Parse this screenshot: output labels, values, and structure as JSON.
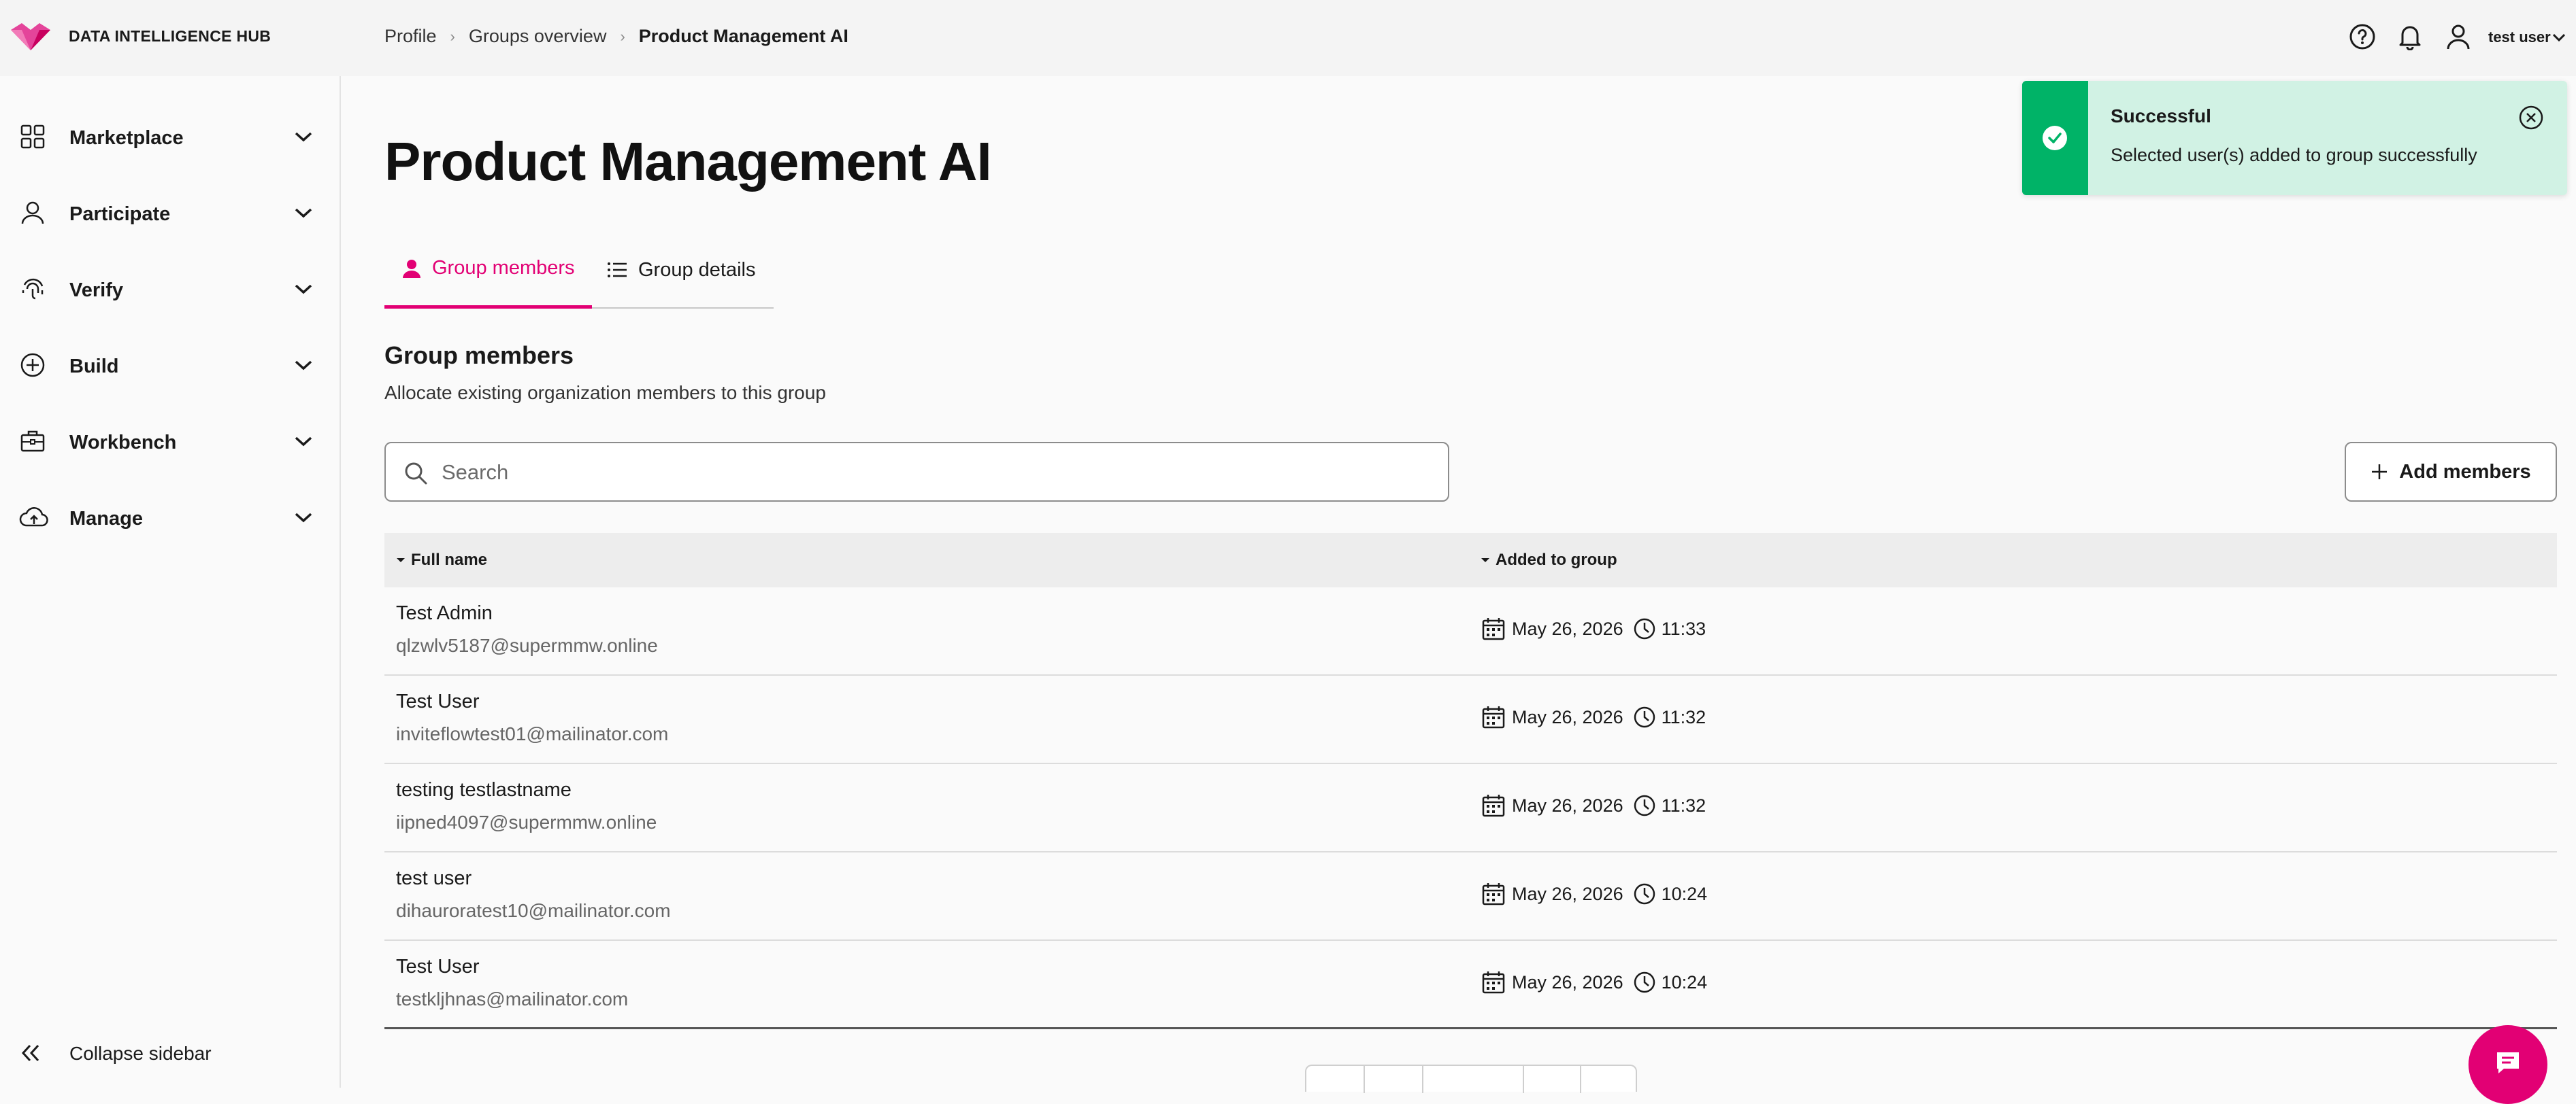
{
  "header": {
    "brand": "DATA INTELLIGENCE HUB",
    "breadcrumb": [
      "Profile",
      "Groups overview",
      "Product Management AI"
    ],
    "user_name": "test user",
    "icons": [
      "help-icon",
      "bell-icon",
      "user-icon",
      "chevron-down-icon"
    ]
  },
  "sidebar": {
    "items": [
      {
        "label": "Marketplace",
        "icon": "grid-icon"
      },
      {
        "label": "Participate",
        "icon": "person-icon"
      },
      {
        "label": "Verify",
        "icon": "fingerprint-icon"
      },
      {
        "label": "Build",
        "icon": "plus-circle-icon"
      },
      {
        "label": "Workbench",
        "icon": "briefcase-icon"
      },
      {
        "label": "Manage",
        "icon": "cloud-upload-icon"
      }
    ],
    "collapse_label": "Collapse sidebar"
  },
  "page": {
    "title": "Product Management AI",
    "tabs": [
      {
        "label": "Group members",
        "active": true
      },
      {
        "label": "Group details",
        "active": false
      }
    ],
    "section_title": "Group members",
    "section_subtitle": "Allocate existing organization members to this group",
    "search_placeholder": "Search",
    "add_button": "Add members"
  },
  "table": {
    "columns": [
      "Full name",
      "Added to group"
    ],
    "rows": [
      {
        "name": "Test Admin",
        "email": "qlzwlv5187@supermmw.online",
        "date": "May 26, 2026",
        "time": "11:33"
      },
      {
        "name": "Test User",
        "email": "inviteflowtest01@mailinator.com",
        "date": "May 26, 2026",
        "time": "11:32"
      },
      {
        "name": "testing testlastname",
        "email": "iipned4097@supermmw.online",
        "date": "May 26, 2026",
        "time": "11:32"
      },
      {
        "name": "test user",
        "email": "dihauroratest10@mailinator.com",
        "date": "May 26, 2026",
        "time": "10:24"
      },
      {
        "name": "Test User",
        "email": "testkljhnas@mailinator.com",
        "date": "May 26, 2026",
        "time": "10:24"
      }
    ]
  },
  "toast": {
    "title": "Successful",
    "message": "Selected user(s) added to group successfully"
  },
  "colors": {
    "accent": "#e20074",
    "success": "#00b367",
    "success_bg": "#d1f2e4"
  }
}
